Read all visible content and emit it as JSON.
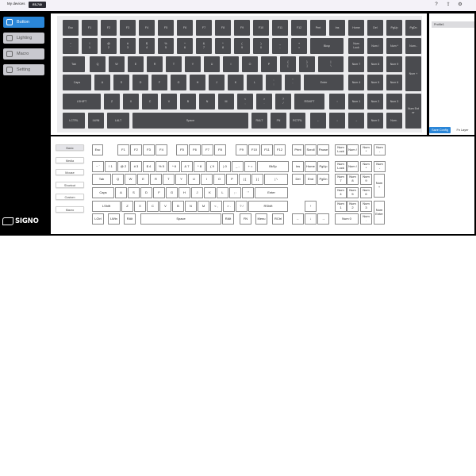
{
  "topbar": {
    "device_label": "My devices",
    "device_model": "ES-740",
    "icons": [
      "help-icon",
      "upload-icon",
      "settings-icon"
    ]
  },
  "sidebar": {
    "items": [
      {
        "label": "Button",
        "icon": "button-icon",
        "active": true
      },
      {
        "label": "Lighting",
        "icon": "lighting-icon",
        "active": false
      },
      {
        "label": "Macro",
        "icon": "macro-icon",
        "active": false
      },
      {
        "label": "Setting",
        "icon": "setting-icon",
        "active": false
      }
    ],
    "logo_text": "SIGNO"
  },
  "keyboard": {
    "rows": [
      [
        [
          "Esc",
          79,
          5
        ],
        [
          "F1",
          103,
          5
        ],
        [
          "F2",
          127,
          5
        ],
        [
          "F3",
          151,
          5
        ],
        [
          "F4",
          175,
          5
        ],
        [
          "F5",
          199,
          5
        ],
        [
          "F6",
          223,
          5
        ],
        [
          "F7",
          247,
          5
        ],
        [
          "F8",
          271,
          5
        ],
        [
          "F9",
          295,
          5
        ],
        [
          "F10",
          319,
          5
        ],
        [
          "F11",
          343,
          5
        ],
        [
          "F12",
          367,
          5
        ],
        [
          "Prnt",
          391,
          5
        ],
        [
          "Ins",
          415,
          5
        ],
        [
          "Home",
          439,
          5
        ],
        [
          "Del",
          463,
          5
        ],
        [
          "PgUp",
          487,
          5
        ],
        [
          "PgDn",
          511,
          5
        ]
      ],
      [
        [
          "~\n`",
          79,
          5
        ],
        [
          "!\n1",
          103,
          5
        ],
        [
          "@\n2",
          127,
          5
        ],
        [
          "#\n3",
          151,
          5
        ],
        [
          "$\n4",
          175,
          5
        ],
        [
          "%\n5",
          199,
          5
        ],
        [
          "^\n6",
          223,
          5
        ],
        [
          "&\n7",
          247,
          5
        ],
        [
          "*\n8",
          271,
          5
        ],
        [
          "(\n9",
          295,
          5
        ],
        [
          ")\n0",
          319,
          5
        ],
        [
          "_\n-",
          343,
          5
        ],
        [
          "+\n=",
          367,
          5
        ],
        [
          "Bksp",
          391,
          5,
          42
        ],
        [
          "Num\nLock",
          439,
          5
        ],
        [
          "Num /",
          463,
          5
        ],
        [
          "Num *",
          487,
          5
        ],
        [
          "Num -",
          511,
          5
        ]
      ],
      [
        [
          "Tab",
          79,
          5,
          28
        ],
        [
          "Q",
          113,
          5
        ],
        [
          "W",
          137,
          5
        ],
        [
          "E",
          161,
          5
        ],
        [
          "R",
          185,
          5
        ],
        [
          "T",
          209,
          5
        ],
        [
          "Y",
          233,
          5
        ],
        [
          "U",
          257,
          5
        ],
        [
          "I",
          281,
          5
        ],
        [
          "O",
          305,
          5
        ],
        [
          "P",
          329,
          5
        ],
        [
          "{\n[",
          353,
          5
        ],
        [
          "}\n]",
          377,
          5
        ],
        [
          "|\n\\",
          401,
          5,
          32
        ],
        [
          "Num 7",
          439,
          5
        ],
        [
          "Num 8",
          463,
          5
        ],
        [
          "Num 9",
          487,
          5
        ],
        [
          "Num +",
          511,
          5,
          20,
          44
        ]
      ],
      [
        [
          "Caps",
          79,
          5,
          36
        ],
        [
          "A",
          119,
          5
        ],
        [
          "S",
          143,
          5
        ],
        [
          "D",
          167,
          5
        ],
        [
          "F",
          191,
          5
        ],
        [
          "G",
          215,
          5
        ],
        [
          "H",
          239,
          5
        ],
        [
          "J",
          263,
          5
        ],
        [
          "K",
          287,
          5
        ],
        [
          "L",
          311,
          5
        ],
        [
          ":\n;",
          335,
          5
        ],
        [
          "\"\n'",
          359,
          5
        ],
        [
          "Enter",
          383,
          5,
          50
        ],
        [
          "Num 4",
          439,
          5
        ],
        [
          "Num 5",
          463,
          5
        ],
        [
          "Num 6",
          487,
          5
        ]
      ],
      [
        [
          "LSHIFT",
          79,
          5,
          48
        ],
        [
          "Z",
          131,
          5
        ],
        [
          "X",
          155,
          5
        ],
        [
          "C",
          179,
          5
        ],
        [
          "V",
          203,
          5
        ],
        [
          "B",
          227,
          5
        ],
        [
          "N",
          251,
          5
        ],
        [
          "M",
          275,
          5
        ],
        [
          "<\n,",
          299,
          5
        ],
        [
          ">\n.",
          323,
          5
        ],
        [
          "?\n/",
          347,
          5
        ],
        [
          "RSHIFT",
          371,
          5,
          38
        ],
        [
          "↑",
          415,
          5
        ],
        [
          "Num 1",
          439,
          5
        ],
        [
          "Num 2",
          463,
          5
        ],
        [
          "Num 3",
          487,
          5
        ],
        [
          "Num Ent\ner",
          511,
          5,
          20,
          44
        ]
      ],
      [
        [
          "LCTRL",
          79,
          5,
          28
        ],
        [
          "LWIN",
          111,
          5
        ],
        [
          "LALT",
          135,
          5,
          28
        ],
        [
          "Space",
          167,
          5,
          146
        ],
        [
          "RALT",
          317,
          5
        ],
        [
          "FN",
          341,
          5
        ],
        [
          "RCTRL",
          365,
          5
        ],
        [
          "←",
          391,
          5
        ],
        [
          "↓",
          415,
          5
        ],
        [
          "→",
          439,
          5,
          20
        ],
        [
          "Num 0",
          463,
          5
        ],
        [
          "Num .",
          487,
          5
        ]
      ]
    ]
  },
  "profile": {
    "items": [
      "Profile1"
    ],
    "save_label": "Save Config",
    "fn_label": "Fn Layer"
  },
  "tabs": [
    "Basic",
    "Media",
    "Mouse",
    "Shortcut",
    "Custom",
    "Macro"
  ],
  "lower_keys": [
    [
      "Esc",
      116,
      0,
      14
    ],
    [
      "F1",
      148,
      0
    ],
    [
      "F2",
      164,
      0
    ],
    [
      "F3",
      180,
      0
    ],
    [
      "F4",
      196,
      0
    ],
    [
      "F5",
      222,
      0
    ],
    [
      "F6",
      238,
      0
    ],
    [
      "F7",
      254,
      0
    ],
    [
      "F8",
      270,
      0
    ],
    [
      "F9",
      297,
      0
    ],
    [
      "F10",
      313,
      0
    ],
    [
      "F11",
      329,
      0
    ],
    [
      "F12",
      345,
      0
    ],
    [
      "Print",
      368,
      0
    ],
    [
      "Scroll",
      384,
      0
    ],
    [
      "Pause",
      400,
      0
    ],
    [
      "Num\nLock",
      422,
      0
    ],
    [
      "Num /",
      437,
      0
    ],
    [
      "Num\n*",
      454,
      0
    ],
    [
      "Num\n-",
      471,
      0
    ],
    [
      "~ `",
      116,
      1
    ],
    [
      "! 1",
      132,
      1
    ],
    [
      "@ 2",
      148,
      1
    ],
    [
      "# 3",
      164,
      1
    ],
    [
      "$ 4",
      180,
      1
    ],
    [
      "% 5",
      196,
      1
    ],
    [
      "^ 6",
      212,
      1
    ],
    [
      "& 7",
      228,
      1
    ],
    [
      "* 8",
      244,
      1
    ],
    [
      "( 9",
      260,
      1
    ],
    [
      ") 0",
      276,
      1
    ],
    [
      "_ -",
      292,
      1
    ],
    [
      "+ =",
      308,
      1
    ],
    [
      "BkSp",
      324,
      1,
      40
    ],
    [
      "Ins",
      368,
      1
    ],
    [
      "Home",
      384,
      1
    ],
    [
      "PgUp",
      400,
      1
    ],
    [
      "Num\nLock",
      422,
      1
    ],
    [
      "Num /",
      437,
      1
    ],
    [
      "Num\n*",
      454,
      1
    ],
    [
      "Num\n-",
      471,
      1
    ],
    [
      "Tab",
      116,
      2,
      24
    ],
    [
      "Q",
      141,
      2
    ],
    [
      "W",
      157,
      2
    ],
    [
      "E",
      173,
      2
    ],
    [
      "R",
      189,
      2
    ],
    [
      "T",
      205,
      2
    ],
    [
      "Y",
      221,
      2
    ],
    [
      "U",
      237,
      2
    ],
    [
      "I",
      253,
      2
    ],
    [
      "O",
      269,
      2
    ],
    [
      "P",
      285,
      2
    ],
    [
      "{ [",
      301,
      2
    ],
    [
      "} ]",
      317,
      2
    ],
    [
      "| \\",
      333,
      2,
      30
    ],
    [
      "Del",
      368,
      2
    ],
    [
      "End",
      384,
      2
    ],
    [
      "PgDn",
      400,
      2
    ],
    [
      "Num\n7",
      422,
      2
    ],
    [
      "Num\n8",
      437,
      2
    ],
    [
      "Num\n9",
      454,
      2
    ],
    [
      "Num\n+",
      471,
      2,
      14,
      30
    ],
    [
      "Caps",
      116,
      3,
      28
    ],
    [
      "A",
      145,
      3
    ],
    [
      "S",
      161,
      3
    ],
    [
      "D",
      177,
      3
    ],
    [
      "F",
      193,
      3
    ],
    [
      "G",
      209,
      3
    ],
    [
      "H",
      225,
      3
    ],
    [
      "J",
      241,
      3
    ],
    [
      "K",
      257,
      3
    ],
    [
      "L",
      273,
      3
    ],
    [
      "; :",
      289,
      3
    ],
    [
      "' \"",
      305,
      3
    ],
    [
      "Enter",
      321,
      3,
      42
    ],
    [
      "Num\n4",
      422,
      3
    ],
    [
      "Num\n5",
      437,
      3
    ],
    [
      "Num\n6",
      454,
      3
    ],
    [
      "LShift",
      116,
      4,
      36
    ],
    [
      "Z",
      153,
      4
    ],
    [
      "X",
      169,
      4
    ],
    [
      "C",
      185,
      4
    ],
    [
      "V",
      201,
      4
    ],
    [
      "B",
      217,
      4
    ],
    [
      "N",
      233,
      4
    ],
    [
      "M",
      249,
      4
    ],
    [
      "< ,",
      265,
      4
    ],
    [
      "> .",
      281,
      4
    ],
    [
      "? /",
      297,
      4
    ],
    [
      "RShift",
      313,
      4,
      50
    ],
    [
      "↑",
      384,
      4
    ],
    [
      "Num\n1",
      422,
      4
    ],
    [
      "Num\n2",
      437,
      4
    ],
    [
      "Num\n3",
      454,
      4
    ],
    [
      "Num\nEnter",
      471,
      4,
      14,
      30
    ],
    [
      "LCtrl",
      116,
      5
    ],
    [
      "LWin",
      136,
      5
    ],
    [
      "RAlt",
      156,
      5
    ],
    [
      "Space",
      177,
      5,
      102
    ],
    [
      "RAlt",
      280,
      5
    ],
    [
      "FN",
      302,
      5
    ],
    [
      "Menu",
      322,
      5
    ],
    [
      "RCtrl",
      343,
      5
    ],
    [
      "←",
      368,
      5
    ],
    [
      "↓",
      384,
      5
    ],
    [
      "→",
      400,
      5
    ],
    [
      "Num 0",
      422,
      5,
      30
    ],
    [
      "Num\n.",
      454,
      5
    ]
  ]
}
